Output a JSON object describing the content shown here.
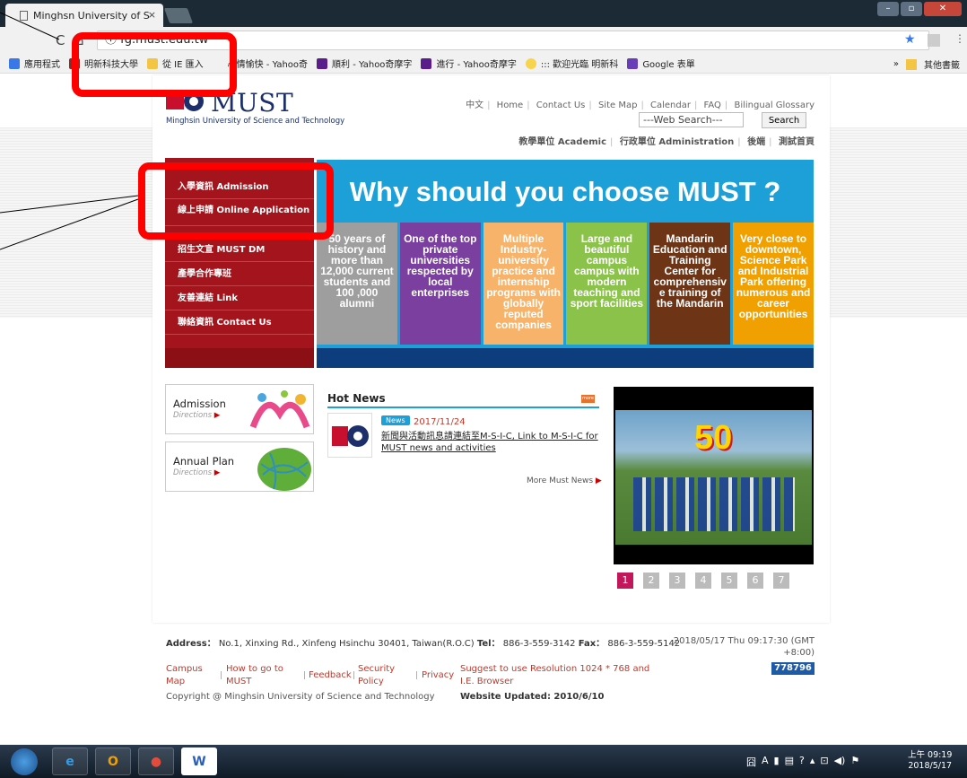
{
  "browser": {
    "tab_title": "Minghsn University of S",
    "tab_close": "×",
    "url": "ⓘ fg.must.edu.tw",
    "bookmarks": [
      "應用程式",
      "明新科技大學",
      "從 IE 匯入",
      "心情愉快 - Yahoo奇",
      "順利 - Yahoo奇摩字",
      "進行 - Yahoo奇摩字",
      "::: 歡迎光臨 明新科",
      "Google 表單"
    ],
    "bookmarks_more": "»",
    "other_bookmarks": "其他書籤"
  },
  "header": {
    "logo_text": "MUST",
    "logo_subtitle": "Minghsin University of Science and Technology",
    "top_links": [
      "中文",
      "Home",
      "Contact Us",
      "Site Map",
      "Calendar",
      "FAQ",
      "Bilingual Glossary"
    ],
    "search_placeholder": "---Web Search---",
    "search_button": "Search",
    "sub_links": [
      "教學單位 Academic",
      "行政單位 Administration",
      "後端",
      "測試首頁"
    ]
  },
  "sidemenu": {
    "items": [
      "入學資訊 Admission",
      "線上申請 Online Application",
      "招生文宣 MUST DM",
      "產學合作專班",
      "友善連結 Link",
      "聯絡資訊 Contact Us"
    ]
  },
  "banner": {
    "title": "Why should you choose MUST ?",
    "tiles": [
      {
        "text": "50 years of history and more than 12,000 current students and 100 ,000 alumni",
        "color": "#9e9e9e"
      },
      {
        "text": "One of the top private universities respected by local enterprises",
        "color": "#7b3fa0"
      },
      {
        "text": "Multiple Industry-university practice and internship programs with globally reputed companies",
        "color": "#f7b36a"
      },
      {
        "text": "Large and beautiful campus campus with modern teaching and sport facilities",
        "color": "#8bc34a"
      },
      {
        "text": "Mandarin Education and Training Center for comprehensive training of the Mandarin",
        "color": "#6d3416"
      },
      {
        "text": "Very close to downtown, Science Park and Industrial Park offering numerous and career opportunities",
        "color": "#f0a000"
      }
    ]
  },
  "boxes": [
    {
      "title": "Admission",
      "link": "Directions"
    },
    {
      "title": "Annual Plan",
      "link": "Directions"
    }
  ],
  "hot_news": {
    "title": "Hot News",
    "more_icon": "more",
    "badge": "News",
    "date": "2017/11/24",
    "headline": "新聞與活動訊息請連結至M-S-I-C, Link to M-S-I-C for MUST news and activities",
    "more_label": "More Must News"
  },
  "photo": {
    "caption": "50"
  },
  "pager": [
    "1",
    "2",
    "3",
    "4",
    "5",
    "6",
    "7"
  ],
  "footer": {
    "address_label": "Address：",
    "address": "No.1, Xinxing Rd., Xinfeng Hsinchu 30401, Taiwan(R.O.C)",
    "tel_label": "Tel：",
    "tel": "886-3-559-3142",
    "fax_label": "Fax：",
    "fax": "886-3-559-5142",
    "datetime": "2018/05/17 Thu 09:17:30 (GMT +8:00)",
    "counter": "778796",
    "links": [
      "Campus Map",
      "How to go to MUST",
      "Feedback",
      "Security Policy",
      "Privacy"
    ],
    "resolution_note": "Suggest to use Resolution 1024 * 768 and I.E. Browser",
    "copyright": "Copyright @ Minghsin University of Science and Technology",
    "updated": "Website Updated: 2010/6/10"
  },
  "taskbar": {
    "time": "上午 09:19",
    "date": "2018/5/17",
    "apps": [
      "IE",
      "Outlook",
      "Chrome",
      "Word"
    ]
  }
}
